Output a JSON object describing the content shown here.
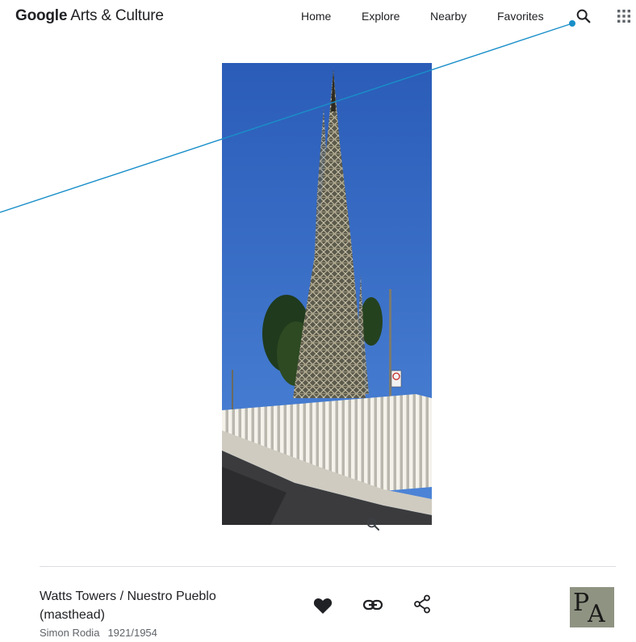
{
  "header": {
    "logo_google": "Google",
    "logo_rest": " Arts & Culture",
    "nav": {
      "home": "Home",
      "explore": "Explore",
      "nearby": "Nearby",
      "favorites": "Favorites"
    },
    "icons": [
      "search-icon",
      "apps-grid-icon"
    ]
  },
  "artwork": {
    "title": "Watts Towers / Nuestro Pueblo (masthead)",
    "creator": "Simon Rodia",
    "date": "1921/1954",
    "image_subject": "Watts Towers spire behind white fence against blue sky",
    "actions": [
      "favorite-heart-icon",
      "copy-link-icon",
      "share-icon"
    ],
    "partner_logo_text": "PA"
  },
  "colors": {
    "sky": "#2d5fb8",
    "annotation": "#1a8fc9",
    "text": "#202124",
    "muted": "#5f6368"
  }
}
